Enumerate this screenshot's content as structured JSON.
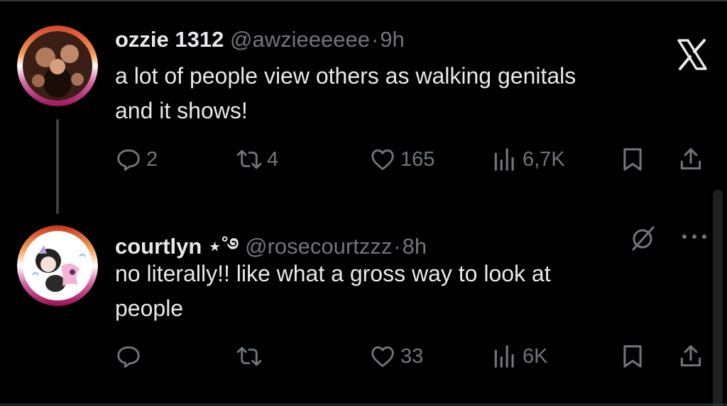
{
  "tweets": [
    {
      "name": "ozzie 1312",
      "handle": "@awzieeeeee",
      "separator": "·",
      "time": "9h",
      "text_lines": [
        "a lot of people view others as walking genitals",
        "and it shows!"
      ],
      "replies": "2",
      "reposts": "4",
      "likes": "165",
      "views": "6,7K"
    },
    {
      "name": "courtlyn ⋆˚࿔",
      "handle": "@rosecourtzzz",
      "separator": "·",
      "time": "8h",
      "text_lines": [
        "no literally!! like what a gross way to look at",
        "people"
      ],
      "likes": "33",
      "views": "6K"
    }
  ],
  "icons": {
    "reply": "reply-icon",
    "repost": "repost-icon",
    "like": "heart-icon",
    "views": "views-icon",
    "bookmark": "bookmark-icon",
    "share": "share-icon",
    "x_logo": "x-logo-icon",
    "grok": "grok-icon",
    "more": "more-icon"
  },
  "colors": {
    "background": "#000000",
    "text": "#e7e9ea",
    "secondary": "#71767b"
  }
}
